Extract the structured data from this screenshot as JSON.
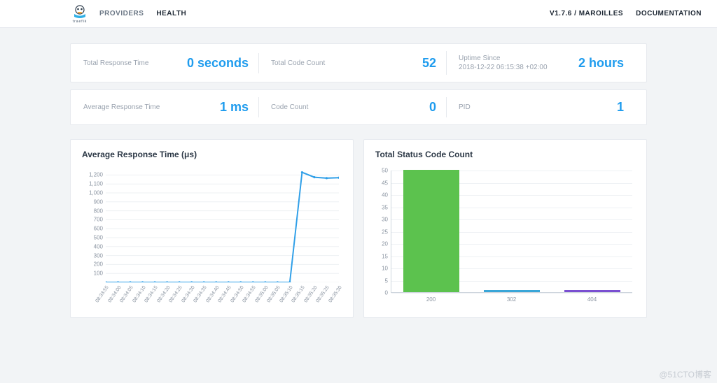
{
  "nav": {
    "logo_text": "traefik",
    "providers": "PROVIDERS",
    "health": "HEALTH",
    "version": "V1.7.6 / MAROILLES",
    "docs": "DOCUMENTATION"
  },
  "stats1": {
    "trt_label": "Total Response Time",
    "trt_value": "0 seconds",
    "tcc_label": "Total Code Count",
    "tcc_value": "52",
    "uptime_label": "Uptime Since\n2018-12-22 06:15:38 +02:00",
    "uptime_value": "2 hours"
  },
  "stats2": {
    "art_label": "Average Response Time",
    "art_value": "1 ms",
    "cc_label": "Code Count",
    "cc_value": "0",
    "pid_label": "PID",
    "pid_value": "1"
  },
  "watermark": "@51CTO博客",
  "chart_data": [
    {
      "type": "line",
      "title": "Average Response Time (μs)",
      "xlabel": "",
      "ylabel": "",
      "ylim": [
        0,
        1250
      ],
      "y_ticks": [
        100,
        200,
        300,
        400,
        500,
        600,
        700,
        800,
        900,
        1000,
        1100,
        1200
      ],
      "x_ticks": [
        "08:33:55",
        "08:34:00",
        "08:34:05",
        "08:34:10",
        "08:34:15",
        "08:34:20",
        "08:34:25",
        "08:34:30",
        "08:34:35",
        "08:34:40",
        "08:34:45",
        "08:34:50",
        "08:34:55",
        "08:35:00",
        "08:35:05",
        "08:35:10",
        "08:35:15",
        "08:35:20",
        "08:35:25",
        "08:35:30"
      ],
      "values": [
        0,
        0,
        0,
        0,
        0,
        0,
        0,
        0,
        0,
        0,
        0,
        0,
        0,
        0,
        0,
        0,
        1230,
        1175,
        1165,
        1170
      ]
    },
    {
      "type": "bar",
      "title": "Total Status Code Count",
      "xlabel": "",
      "ylabel": "",
      "ylim": [
        0,
        50
      ],
      "y_ticks": [
        0,
        5,
        10,
        15,
        20,
        25,
        30,
        35,
        40,
        45,
        50
      ],
      "categories": [
        "200",
        "302",
        "404"
      ],
      "values": [
        50,
        1,
        1
      ],
      "colors": [
        "#5cc24e",
        "#3aa6d8",
        "#7a4fd1"
      ]
    }
  ]
}
